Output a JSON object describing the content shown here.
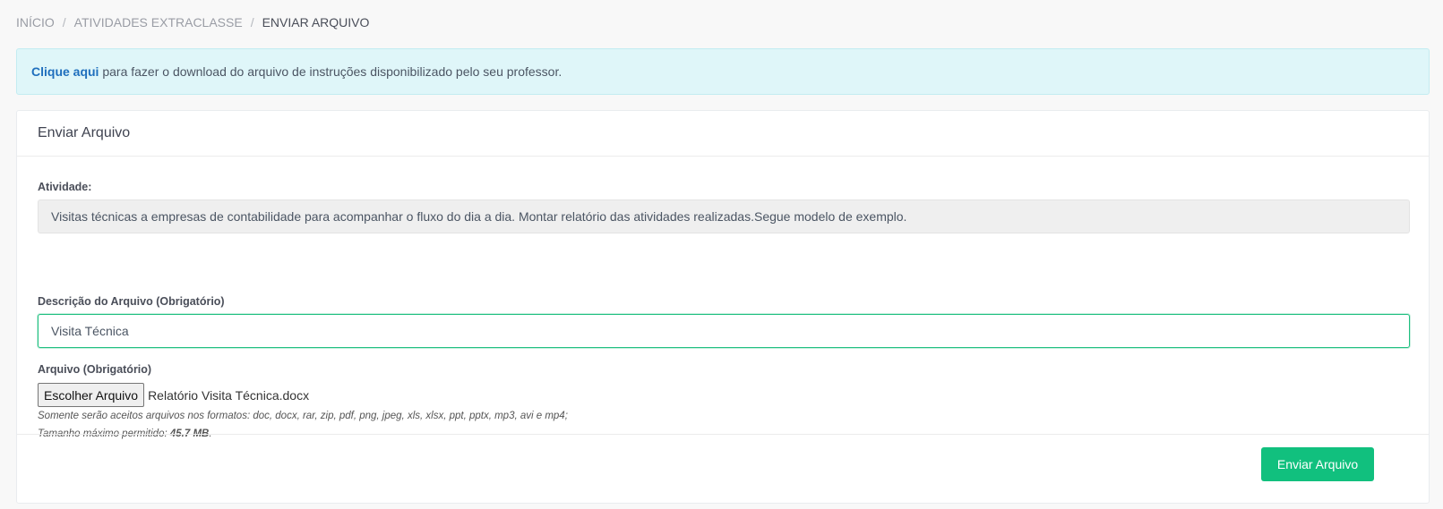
{
  "breadcrumb": {
    "items": [
      "INÍCIO",
      "ATIVIDADES EXTRACLASSE",
      "ENVIAR ARQUIVO"
    ],
    "separator": "/"
  },
  "alert": {
    "link_text": "Clique aqui",
    "message": " para fazer o download do arquivo de instruções disponibilizado pelo seu professor."
  },
  "card": {
    "title": "Enviar Arquivo",
    "activity": {
      "label": "Atividade:",
      "value": "Visitas técnicas a empresas de contabilidade para acompanhar o fluxo do dia a dia. Montar relatório das atividades realizadas.Segue modelo de exemplo."
    },
    "description": {
      "label": "Descrição do Arquivo (Obrigatório)",
      "value": "Visita Técnica"
    },
    "file": {
      "label": "Arquivo (Obrigatório)",
      "button_label": "Escolher Arquivo",
      "selected_file": "Relatório Visita Técnica.docx",
      "formats_note": "Somente serão aceitos arquivos nos formatos: doc, docx, rar, zip, pdf, png, jpeg, xls, xlsx, ppt, pptx, mp3, avi e mp4;",
      "max_size_prefix": "Tamanho máximo permitido: ",
      "max_size_value": "45.7 MB",
      "max_size_suffix": "."
    },
    "submit_label": "Enviar Arquivo"
  },
  "colors": {
    "accent_green": "#11c07e",
    "alert_bg": "#dff6f9",
    "link_blue": "#1f6fbd"
  }
}
